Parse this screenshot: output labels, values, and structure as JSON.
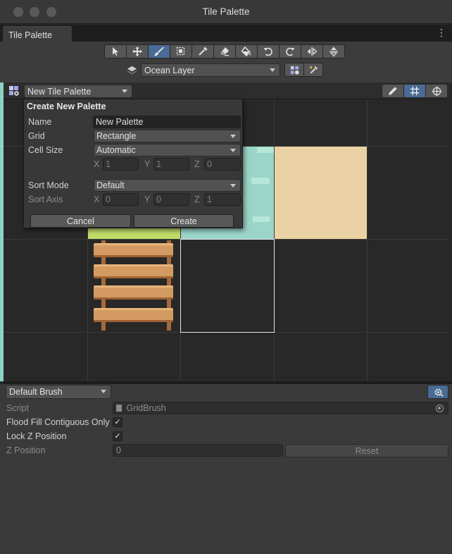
{
  "window": {
    "title": "Tile Palette"
  },
  "tab": {
    "label": "Tile Palette",
    "menu_glyph": "⋮"
  },
  "toolbar": {
    "tools": [
      {
        "name": "select",
        "icon": "arrow-cursor-icon",
        "active": false
      },
      {
        "name": "move",
        "icon": "move-arrows-icon",
        "active": false
      },
      {
        "name": "paint",
        "icon": "paintbrush-icon",
        "active": true
      },
      {
        "name": "box-fill",
        "icon": "box-fill-icon",
        "active": false
      },
      {
        "name": "pick",
        "icon": "eyedropper-icon",
        "active": false
      },
      {
        "name": "erase",
        "icon": "eraser-icon",
        "active": false
      },
      {
        "name": "flood-fill",
        "icon": "paint-bucket-icon",
        "active": false
      },
      {
        "name": "rotate-ccw",
        "icon": "rotate-ccw-icon",
        "active": false
      },
      {
        "name": "rotate-cw",
        "icon": "rotate-cw-icon",
        "active": false
      },
      {
        "name": "flip-x",
        "icon": "flip-horizontal-icon",
        "active": false
      },
      {
        "name": "flip-y",
        "icon": "flip-vertical-icon",
        "active": false
      }
    ],
    "active_target": "Ocean Layer"
  },
  "palette": {
    "selected": "New Tile Palette"
  },
  "create_palette": {
    "title": "Create New Palette",
    "name_label": "Name",
    "name_value": "New Palette",
    "grid_label": "Grid",
    "grid_value": "Rectangle",
    "cell_size_label": "Cell Size",
    "cell_size_value": "Automatic",
    "cell_x": "1",
    "cell_y": "1",
    "cell_z": "0",
    "sort_mode_label": "Sort Mode",
    "sort_mode_value": "Default",
    "sort_axis_label": "Sort Axis",
    "sort_x": "0",
    "sort_y": "0",
    "sort_z": "1",
    "axis_x": "X",
    "axis_y": "Y",
    "axis_z": "Z",
    "cancel_label": "Cancel",
    "create_label": "Create"
  },
  "inspector": {
    "brush": "Default Brush",
    "script_label": "Script",
    "script_value": "GridBrush",
    "flood_fill_label": "Flood Fill Contiguous Only",
    "flood_fill_checked": true,
    "lock_z_label": "Lock Z Position",
    "lock_z_checked": true,
    "z_position_label": "Z Position",
    "z_position_value": "0",
    "reset_label": "Reset",
    "check_glyph": "✓"
  },
  "colors": {
    "accent": "#4a6b94",
    "water": "#9bd4c8",
    "sand": "#ebd2a4",
    "grass": "#c2dc6a",
    "wood": "#d39b62"
  }
}
